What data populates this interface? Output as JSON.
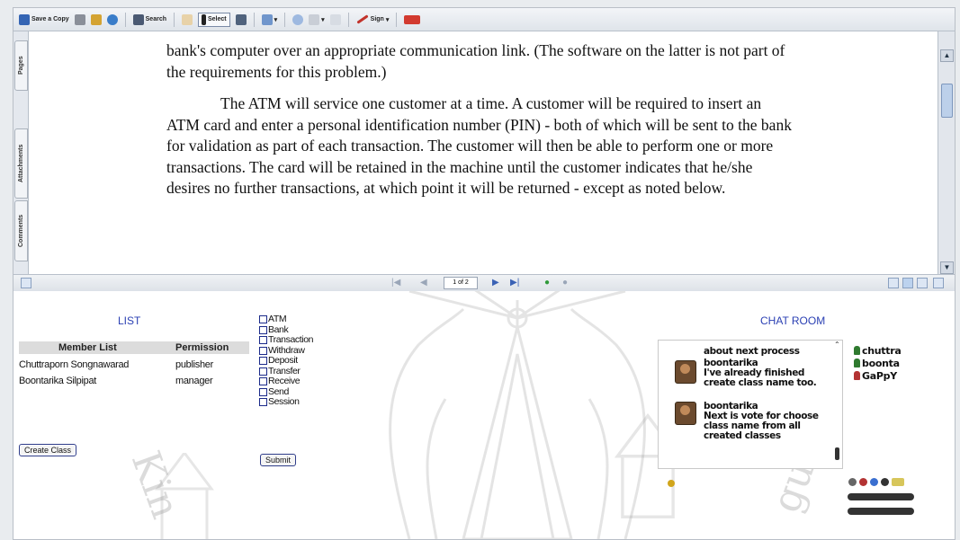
{
  "toolbar": {
    "save_copy": "Save a Copy",
    "search": "Search",
    "select": "Select",
    "sign": "Sign"
  },
  "side_tabs": [
    "Pages",
    "Attachments",
    "Comments"
  ],
  "document": {
    "para1": "bank's computer over an appropriate communication link. (The software on the latter is not part of the requirements for this problem.)",
    "para2": "The ATM will service one customer at a time. A customer will be required to insert an ATM card and enter a personal identification number (PIN) - both of which will be sent to the bank for validation as part of each transaction. The customer will then be able to perform one or more transactions. The card will be retained in the machine until the customer indicates that he/she desires no further transactions, at which point it will be returned - except as noted below."
  },
  "navigation": {
    "page_indicator": "1 of 2"
  },
  "list_panel": {
    "title": "LIST",
    "header_member": "Member List",
    "header_permission": "Permission",
    "members": [
      {
        "name": "Chuttraporn Songnawarad",
        "permission": "publisher"
      },
      {
        "name": "Boontarika Silpipat",
        "permission": "manager"
      }
    ],
    "create_button": "Create Class"
  },
  "class_checklist": {
    "items": [
      "ATM",
      "Bank",
      "Transaction",
      "Withdraw",
      "Deposit",
      "Transfer",
      "Receive",
      "Send",
      "Session"
    ],
    "submit_label": "Submit"
  },
  "chat_room": {
    "title": "CHAT ROOM",
    "messages": [
      {
        "text": "about next process"
      },
      {
        "user": "boontarika",
        "text": "I've already finished create class name too."
      },
      {
        "user": "boontarika",
        "text": "Next is vote for choose class name from all created classes"
      }
    ],
    "users": [
      "chuttra",
      "boonta",
      "GaPpY"
    ]
  },
  "watermark_text": {
    "left": "Kin",
    "right": "gue"
  },
  "colors": {
    "title_blue": "#2a3fb3",
    "toolbar_bg": "#e4e8ee",
    "user_green": "#2f7a2f",
    "user_red": "#b33333"
  }
}
